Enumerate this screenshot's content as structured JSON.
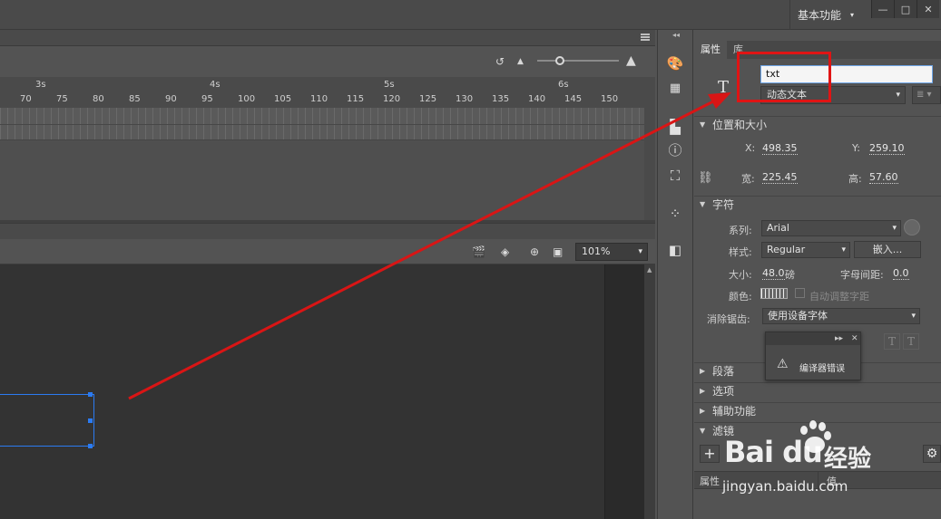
{
  "topbar": {
    "workspace": "基本功能",
    "minimize": "—",
    "maximize": "□",
    "close": "✕"
  },
  "timeline": {
    "seconds": [
      "3s",
      "4s",
      "5s",
      "6s"
    ],
    "frames": [
      "70",
      "75",
      "80",
      "85",
      "90",
      "95",
      "100",
      "105",
      "110",
      "115",
      "120",
      "125",
      "130",
      "135",
      "140",
      "145",
      "150"
    ]
  },
  "stage": {
    "zoom": "101%"
  },
  "panel": {
    "tabs": [
      "属性",
      "库"
    ],
    "instance_name": "txt",
    "text_type": "动态文本",
    "sections": {
      "position": "位置和大小",
      "character": "字符",
      "paragraph": "段落",
      "options": "选项",
      "accessibility": "辅助功能",
      "filters": "滤镜"
    },
    "position": {
      "x_label": "X:",
      "x": "498.35",
      "y_label": "Y:",
      "y": "259.10",
      "w_label": "宽:",
      "w": "225.45",
      "h_label": "高:",
      "h": "57.60"
    },
    "character": {
      "family_label": "系列:",
      "family": "Arial",
      "style_label": "样式:",
      "style": "Regular",
      "embed": "嵌入...",
      "size_label": "大小:",
      "size": "48.0",
      "size_unit": "磅",
      "spacing_label": "字母间距:",
      "spacing": "0.0",
      "color_label": "颜色:",
      "autokern": "自动调整字距",
      "aa_label": "消除锯齿:",
      "aa": "使用设备字体"
    },
    "filter_cols": {
      "prop": "属性",
      "value": "值"
    }
  },
  "popup": {
    "message": "编译器错误"
  },
  "watermark": {
    "logo": "Bai du",
    "cn": "经验",
    "url": "jingyan.baidu.com"
  }
}
